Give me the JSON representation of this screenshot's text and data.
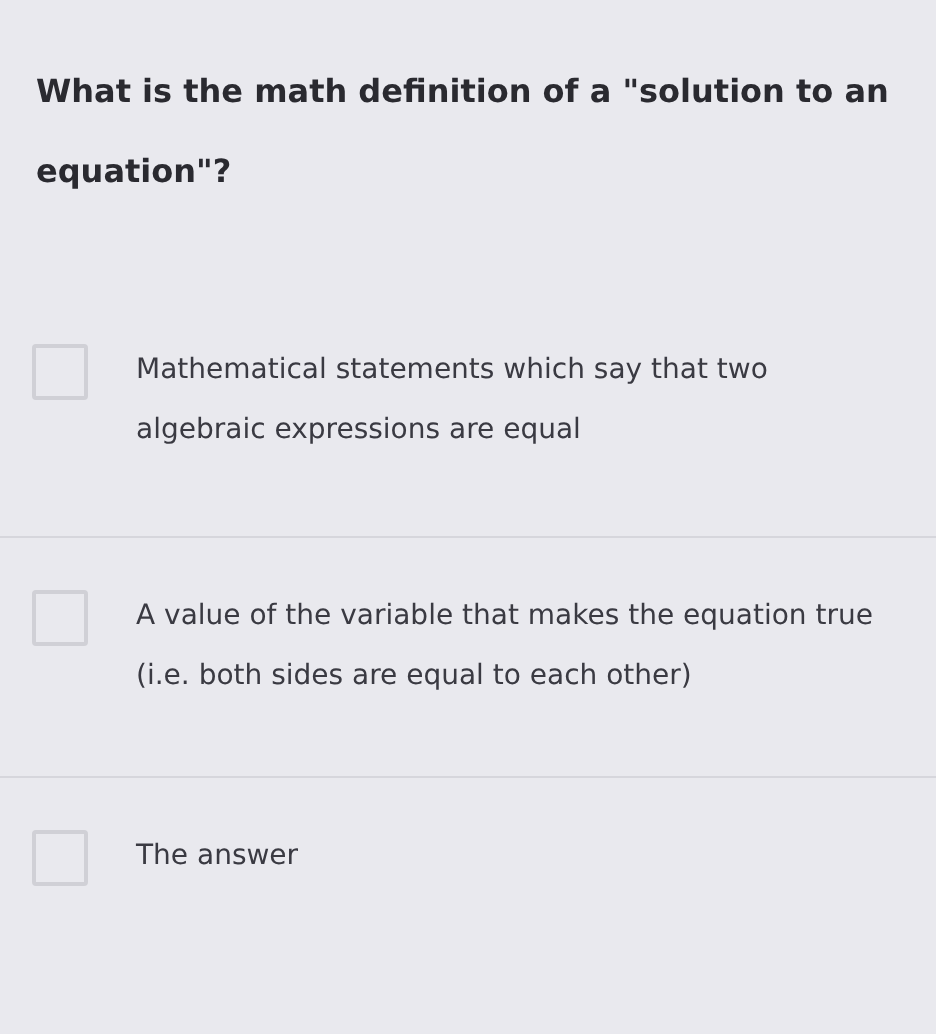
{
  "question": "What is the math definition of a \"solution to an equation\"?",
  "options": [
    {
      "text": "Mathematical statements which say that two algebraic expressions are equal",
      "checked": false
    },
    {
      "text": "A value of the variable that makes the equation true (i.e. both sides are equal to each other)",
      "checked": false
    },
    {
      "text": "The answer",
      "checked": false
    }
  ]
}
